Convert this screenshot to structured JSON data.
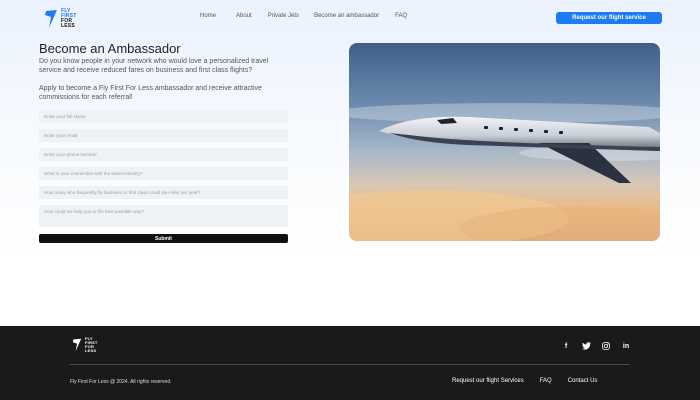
{
  "brand": {
    "logo_lines": [
      "FLY",
      "FIRST",
      "FOR",
      "LESS"
    ],
    "accent_color": "#1f7bf0"
  },
  "header": {
    "nav": [
      "Home",
      "About",
      "Private Jets",
      "Become an ambassador",
      "FAQ"
    ],
    "cta_label": "Request our flight service"
  },
  "main": {
    "title": "Become an Ambassador",
    "paragraph_1": "Do you know people in your network who would love a personalized travel service and receive reduced fares on business and first class flights?",
    "paragraph_2": "Apply to become a Fly First For Less ambassador and receive attractive commissions for each referral!",
    "form": {
      "fields": [
        "Enter your full Name",
        "Enter your email",
        "Enter your phone Number",
        "What is your connection with the travel industry?",
        "How many who frequently fly business or first class could you refer per year?",
        "How could we help you in the best possible way?"
      ],
      "submit_label": "Submit"
    },
    "hero_image": "private-jet-in-flight-sunset"
  },
  "footer": {
    "copyright": "Fly First For Less @ 2024. All rights reserved.",
    "links": [
      "Request our flight Services",
      "FAQ",
      "Contact Us"
    ],
    "socials": [
      "facebook-icon",
      "twitter-icon",
      "instagram-icon",
      "linkedin-icon"
    ]
  }
}
